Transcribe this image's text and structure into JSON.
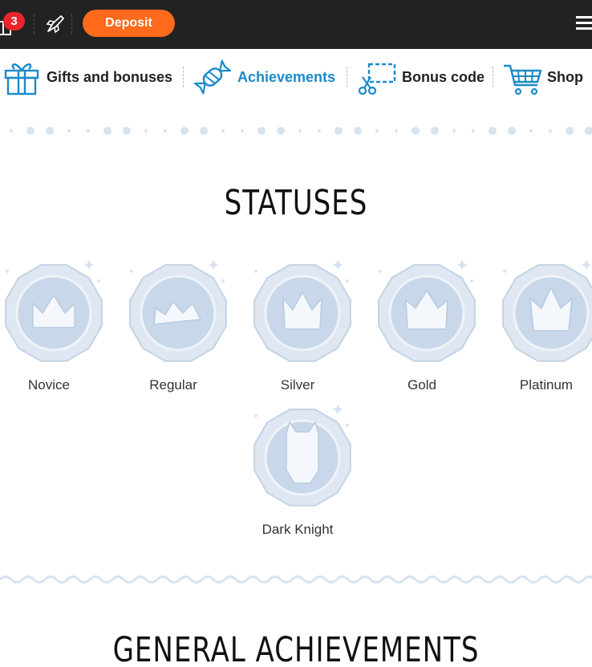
{
  "header": {
    "notification_count": "3",
    "deposit_label": "Deposit",
    "accent_color": "#ff6a1c",
    "badge_color": "#e8262b"
  },
  "tabs": [
    {
      "label": "Gifts and bonuses",
      "icon": "gift-icon",
      "active": false
    },
    {
      "label": "Achievements",
      "icon": "candy-icon",
      "active": true
    },
    {
      "label": "Bonus code",
      "icon": "scissors-coupon-icon",
      "active": false
    },
    {
      "label": "Shop",
      "icon": "cart-icon",
      "active": false
    }
  ],
  "statuses_section": {
    "title": "STATUSES",
    "items": [
      {
        "name": "Novice",
        "icon": "crown-medal-icon"
      },
      {
        "name": "Regular",
        "icon": "crown-medal-icon"
      },
      {
        "name": "Silver",
        "icon": "crown-medal-icon"
      },
      {
        "name": "Gold",
        "icon": "crown-medal-icon"
      },
      {
        "name": "Platinum",
        "icon": "crown-medal-icon"
      },
      {
        "name": "Dark Knight",
        "icon": "knight-helmet-medal-icon"
      }
    ]
  },
  "general_section": {
    "title": "GENERAL ACHIEVEMENTS"
  },
  "colors": {
    "topbar": "#222222",
    "active_tab": "#1a8ac8",
    "medal": "#d6e1ee"
  }
}
